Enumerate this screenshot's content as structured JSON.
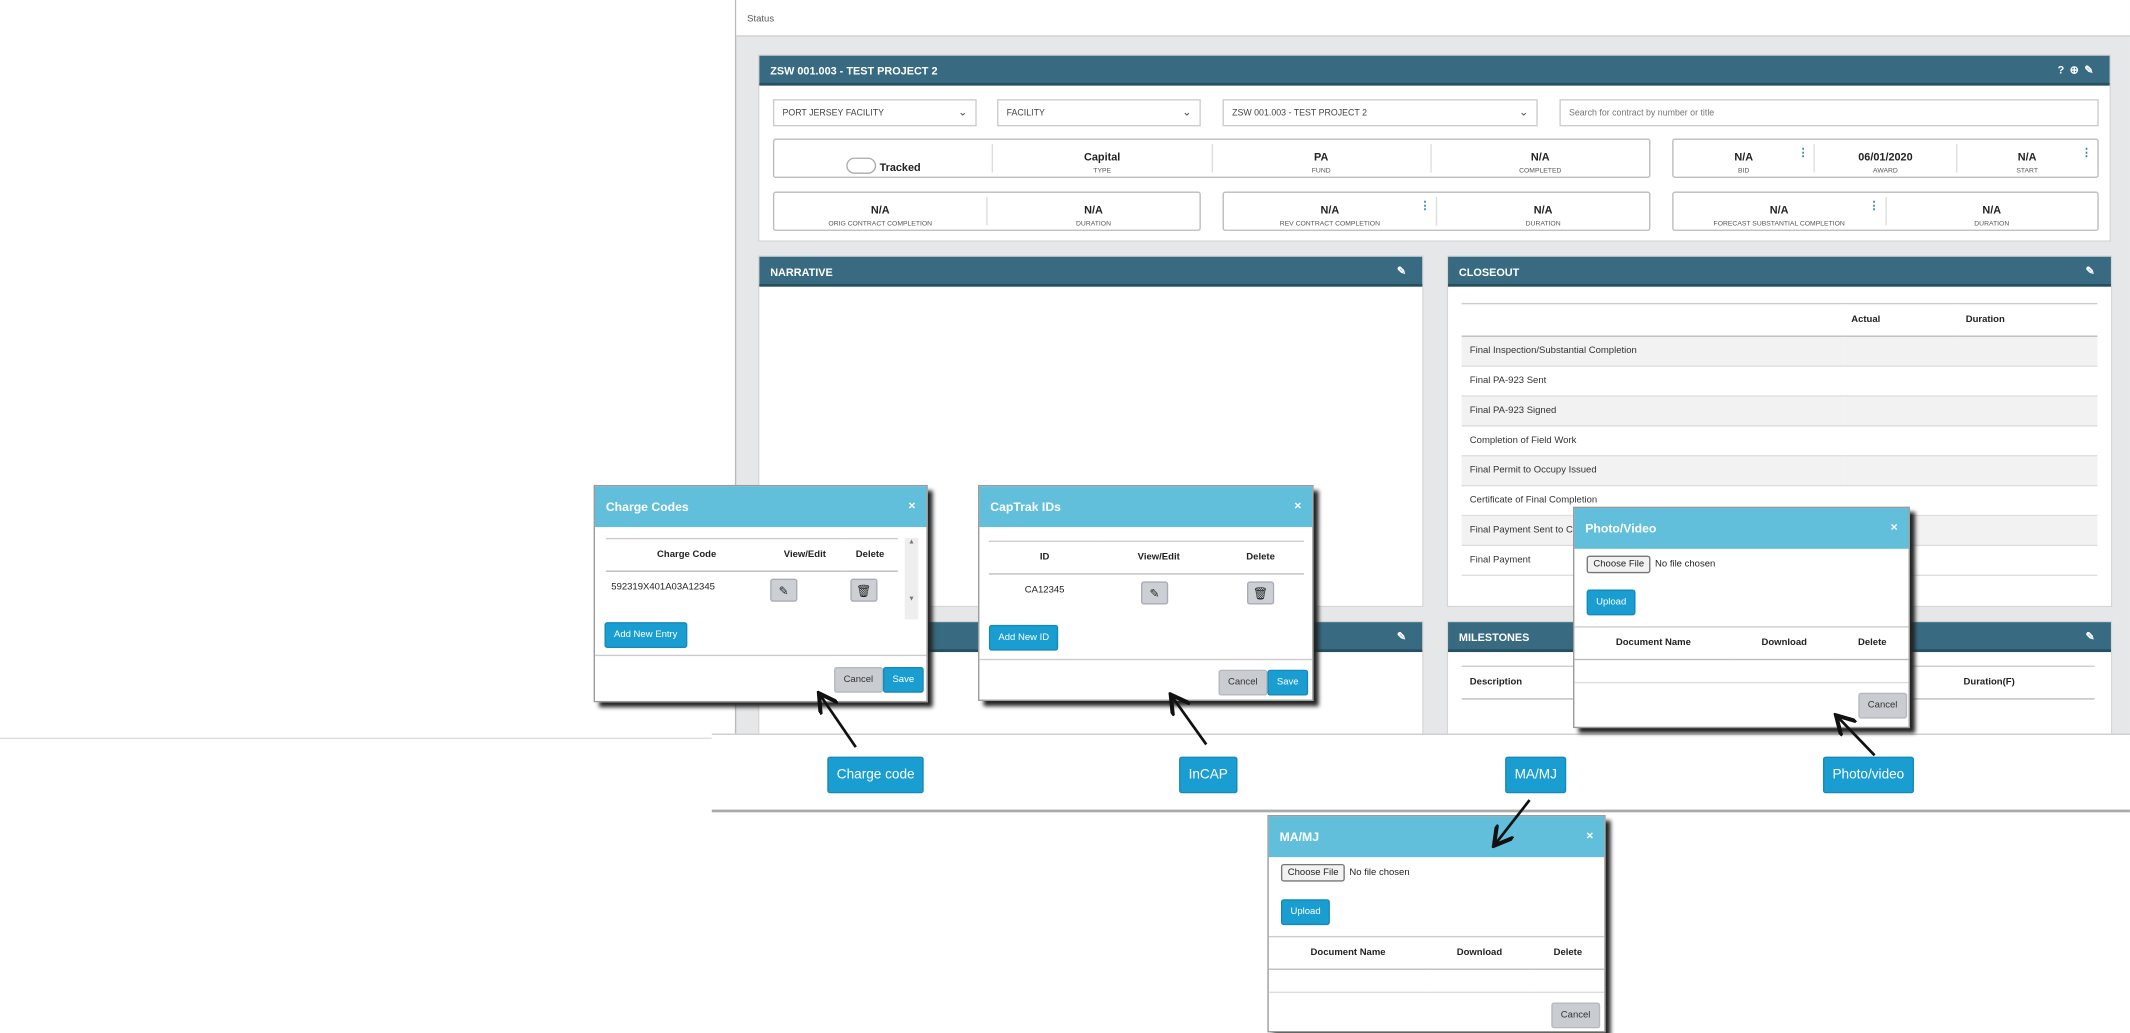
{
  "status_bar": {
    "label": "Status"
  },
  "project": {
    "title": "ZSW 001.003 - TEST PROJECT 2",
    "icons": [
      "help-icon",
      "plus-circle-icon",
      "edit-icon"
    ],
    "filters": {
      "facility_group": "PORT JERSEY FACILITY",
      "facility": "FACILITY",
      "contract": "ZSW 001.003 - TEST PROJECT 2",
      "search_placeholder": "Search for contract by number or title"
    },
    "info": {
      "tracked": "Tracked",
      "type": {
        "value": "Capital",
        "label": "TYPE"
      },
      "fund": {
        "value": "PA",
        "label": "FUND"
      },
      "completed": {
        "value": "N/A",
        "label": "COMPLETED"
      },
      "bid": {
        "value": "N/A",
        "label": "BID"
      },
      "award": {
        "value": "06/01/2020",
        "label": "AWARD"
      },
      "start": {
        "value": "N/A",
        "label": "START"
      },
      "orig": {
        "value": "N/A",
        "label": "ORIG CONTRACT COMPLETION"
      },
      "orig_dur": {
        "value": "N/A",
        "label": "DURATION"
      },
      "rev": {
        "value": "N/A",
        "label": "REV CONTRACT COMPLETION"
      },
      "rev_dur": {
        "value": "N/A",
        "label": "DURATION"
      },
      "forecast": {
        "value": "N/A",
        "label": "FORECAST SUBSTANTIAL COMPLETION"
      },
      "forecast_dur": {
        "value": "N/A",
        "label": "DURATION"
      }
    }
  },
  "narrative": {
    "title": "NARRATIVE"
  },
  "closeout": {
    "title": "CLOSEOUT",
    "columns": [
      "",
      "Actual",
      "Duration"
    ],
    "rows": [
      "Final Inspection/Substantial Completion",
      "Final PA-923 Sent",
      "Final PA-923 Signed",
      "Completion of Field Work",
      "Final Permit to Occupy Issued",
      "Certificate of Final Completion",
      "Final Payment Sent to CM",
      "Final Payment"
    ]
  },
  "milestones": {
    "title": "MILESTONES",
    "columns": [
      "Description",
      "Duration(F)"
    ]
  },
  "charge_modal": {
    "title": "Charge Codes",
    "columns": [
      "Charge Code",
      "View/Edit",
      "Delete"
    ],
    "rows": [
      {
        "code": "592319X401A03A12345"
      }
    ],
    "add": "Add New Entry",
    "cancel": "Cancel",
    "save": "Save"
  },
  "captrak_modal": {
    "title": "CapTrak IDs",
    "columns": [
      "ID",
      "View/Edit",
      "Delete"
    ],
    "rows": [
      {
        "id": "CA12345"
      }
    ],
    "add": "Add New ID",
    "cancel": "Cancel",
    "save": "Save"
  },
  "photo_modal": {
    "title": "Photo/Video",
    "choose": "Choose File",
    "no_file": "No file chosen",
    "upload": "Upload",
    "columns": [
      "Document Name",
      "Download",
      "Delete"
    ],
    "cancel": "Cancel"
  },
  "mamj_modal": {
    "title": "MA/MJ",
    "choose": "Choose File",
    "no_file": "No file chosen",
    "upload": "Upload",
    "columns": [
      "Document Name",
      "Download",
      "Delete"
    ],
    "cancel": "Cancel"
  },
  "callouts": {
    "charge": "Charge code",
    "incap": "InCAP",
    "mamj": "MA/MJ",
    "photo": "Photo/video"
  },
  "colors": {
    "panel_header": "#386b82",
    "modal_header": "#62bfdc",
    "button": "#1a9ed1"
  }
}
